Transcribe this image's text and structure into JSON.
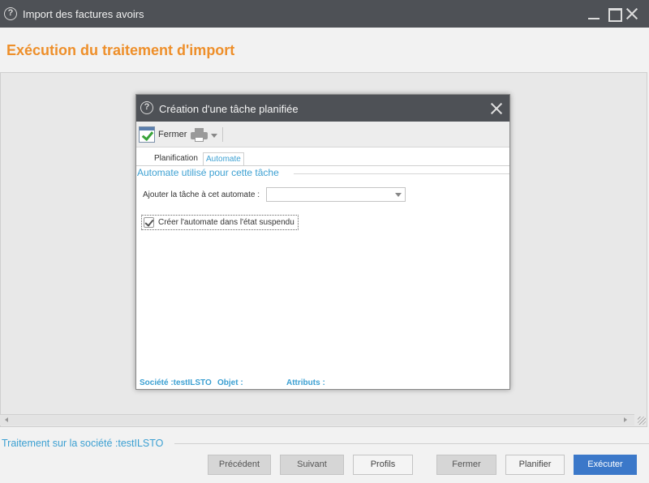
{
  "window": {
    "help_glyph": "?",
    "title": "Import des factures avoirs"
  },
  "page": {
    "title": "Exécution du traitement d'import"
  },
  "footer": {
    "section_title": "Traitement sur la société :testILSTO",
    "buttons": {
      "prev": "Précédent",
      "next": "Suivant",
      "profils": "Profils",
      "fermer": "Fermer",
      "planifier": "Planifier",
      "executer": "Exécuter"
    }
  },
  "modal": {
    "help_glyph": "?",
    "title": "Création d'une tâche planifiée",
    "toolbar": {
      "fermer_label": "Fermer"
    },
    "tabs": [
      {
        "label": "Planification",
        "active": false
      },
      {
        "label": "Automate",
        "active": true
      }
    ],
    "section_title": "Automate utilisé pour cette tâche",
    "automate_field": {
      "label": "Ajouter la tâche à cet automate :",
      "value": ""
    },
    "suspend_checkbox": {
      "label": "Créer l'automate dans l'état suspendu",
      "checked": true
    },
    "status": {
      "societe": "Société :testILSTO",
      "objet": "Objet :",
      "attributs": "Attributs :"
    }
  },
  "colors": {
    "titlebar": "#4e5156",
    "page_title": "#ee8f2a",
    "accent_blue": "#3ca0d2",
    "primary_button": "#3b78c9"
  }
}
